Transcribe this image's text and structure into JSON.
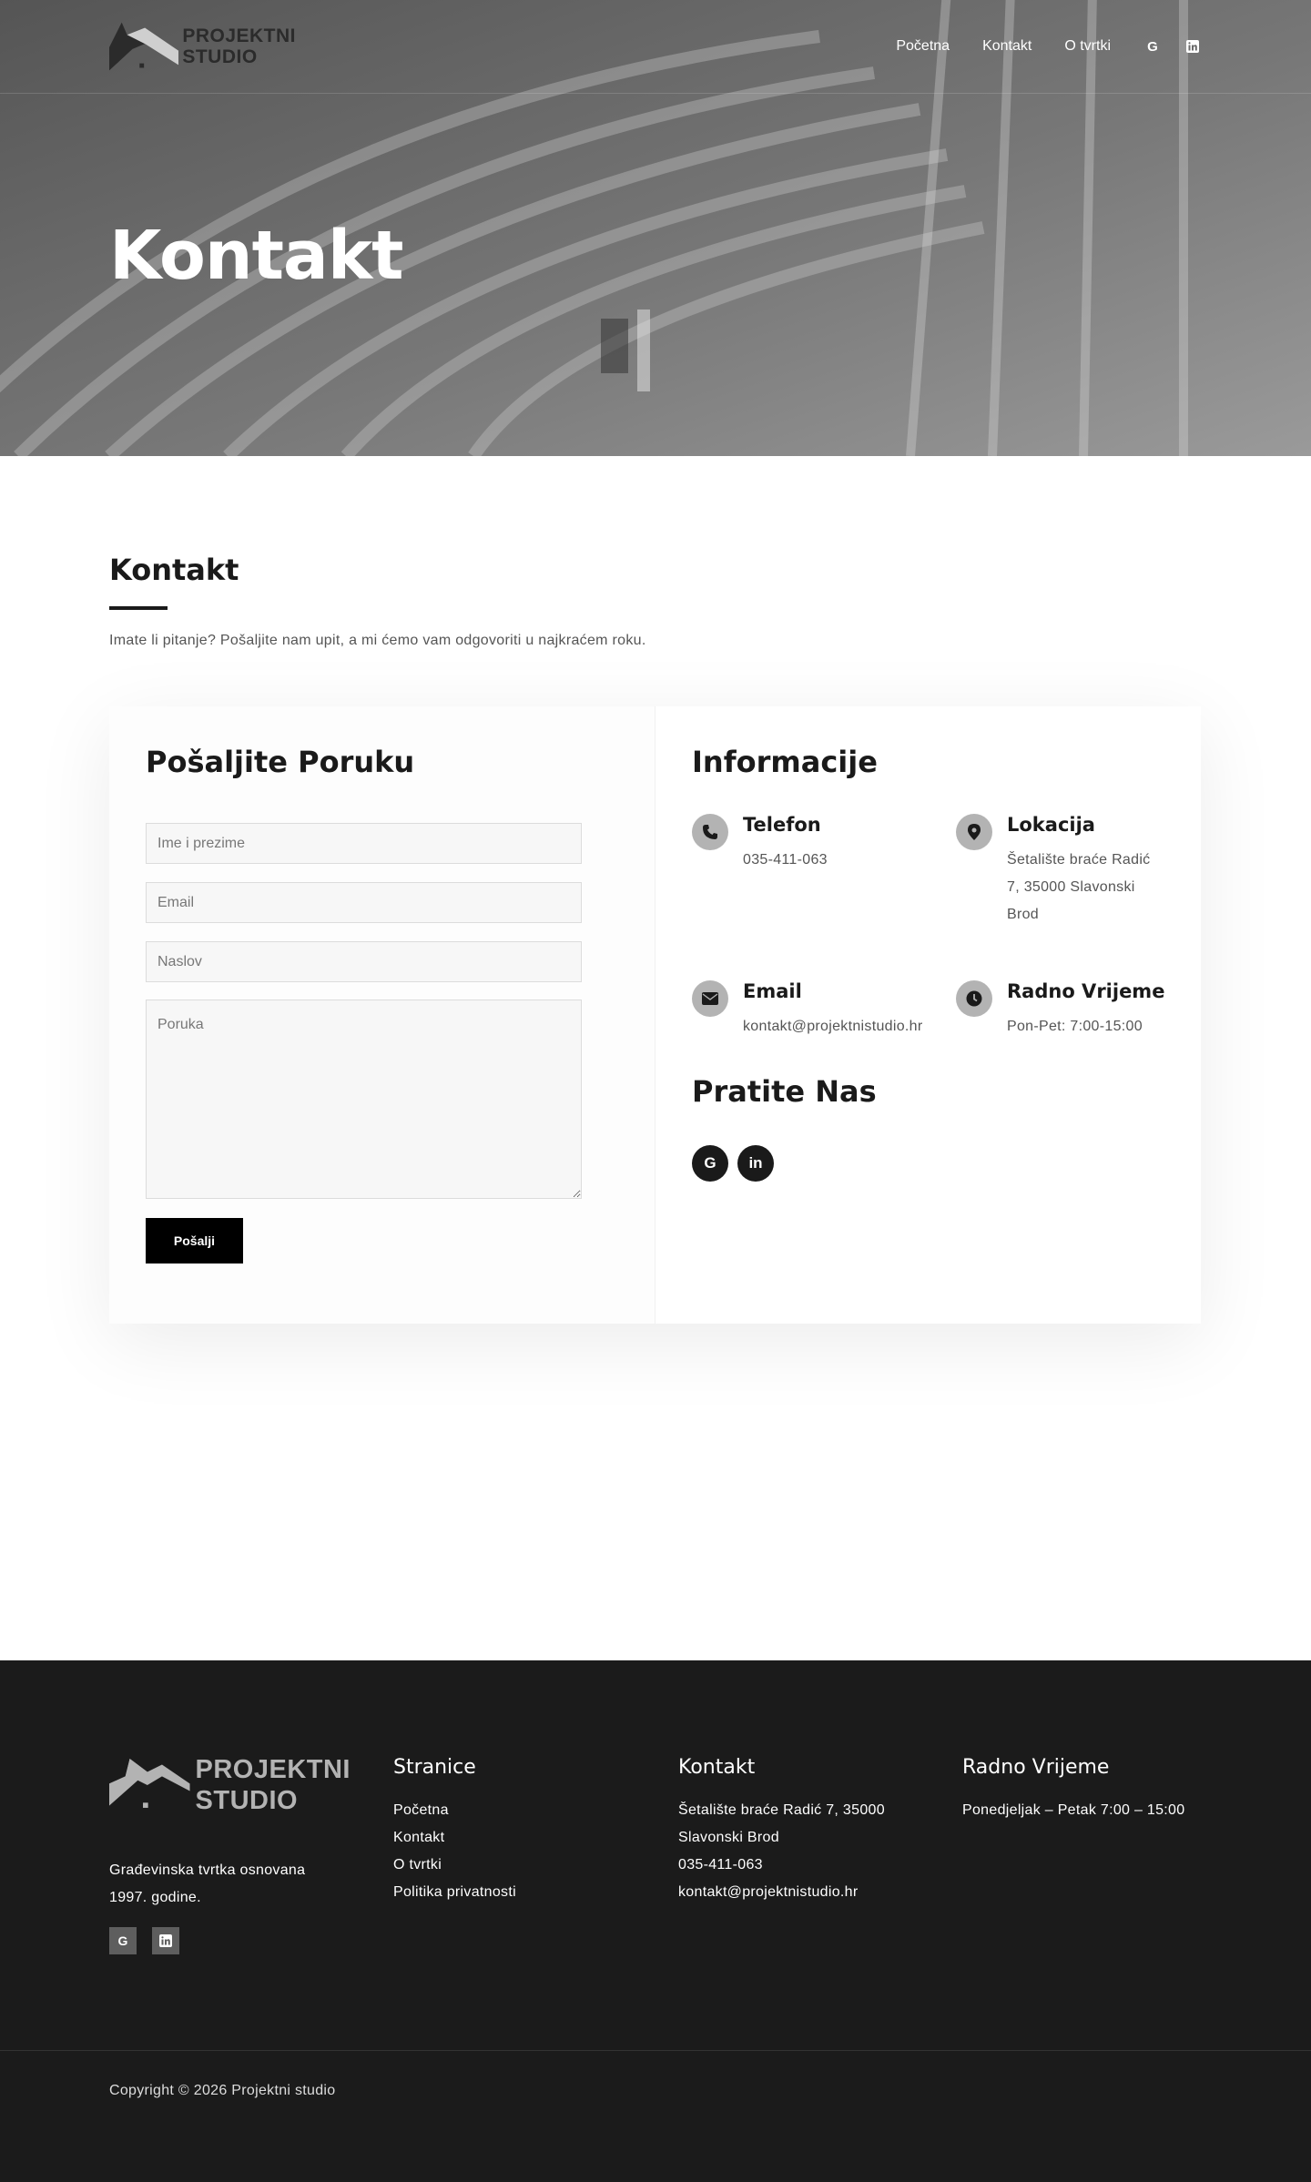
{
  "brand": {
    "logo_line1": "PROJEKTNI",
    "logo_line2": "STUDIO"
  },
  "nav": {
    "items": [
      {
        "label": "Početna"
      },
      {
        "label": "Kontakt"
      },
      {
        "label": "O tvrtki"
      }
    ],
    "social": [
      {
        "icon": "google-icon",
        "glyph": "G"
      },
      {
        "icon": "linkedin-icon",
        "glyph": "in"
      }
    ]
  },
  "hero": {
    "title": "Kontakt"
  },
  "intro": {
    "title": "Kontakt",
    "text": "Imate li pitanje? Pošaljite nam upit, a mi ćemo vam odgovoriti u najkraćem roku."
  },
  "form": {
    "title": "Pošaljite Poruku",
    "name_placeholder": "Ime i prezime",
    "email_placeholder": "Email",
    "subject_placeholder": "Naslov",
    "message_placeholder": "Poruka",
    "submit_label": "Pošalji"
  },
  "info": {
    "title": "Informacije",
    "phone": {
      "title": "Telefon",
      "value": "035-411-063",
      "icon": "phone-icon"
    },
    "location": {
      "title": "Lokacija",
      "value_line1": "Šetalište braće Radić",
      "value_line2": "7, 35000 Slavonski",
      "value_line3": "Brod",
      "icon": "map-pin-icon"
    },
    "email": {
      "title": "Email",
      "value": "kontakt@projektnistudio.hr",
      "icon": "envelope-icon"
    },
    "hours": {
      "title": "Radno Vrijeme",
      "value": "Pon-Pet: 7:00-15:00",
      "icon": "clock-icon"
    },
    "follow_title": "Pratite Nas",
    "social": [
      {
        "icon": "google-icon",
        "glyph": "G"
      },
      {
        "icon": "linkedin-icon",
        "glyph": "in"
      }
    ]
  },
  "footer": {
    "logo_line1": "PROJEKTNI",
    "logo_line2": "STUDIO",
    "about_line1": "Građevinska tvrtka osnovana",
    "about_line2": "1997. godine.",
    "social": [
      {
        "icon": "google-icon",
        "glyph": "G"
      },
      {
        "icon": "linkedin-icon",
        "glyph": "in"
      }
    ],
    "pages": {
      "title": "Stranice",
      "links": [
        "Početna",
        "Kontakt",
        "O tvrtki",
        "Politika privatnosti"
      ]
    },
    "contact": {
      "title": "Kontakt",
      "lines": [
        "Šetalište braće Radić 7, 35000",
        "Slavonski Brod",
        "035-411-063",
        "kontakt@projektnistudio.hr"
      ]
    },
    "hours": {
      "title": "Radno Vrijeme",
      "text": "Ponedjeljak – Petak 7:00 – 15:00"
    },
    "copyright": "Copyright © 2026 Projektni studio"
  },
  "colors": {
    "accent": "#000000",
    "footer_bg": "#1b1b1b",
    "icon_bg": "#b3b3b3"
  }
}
